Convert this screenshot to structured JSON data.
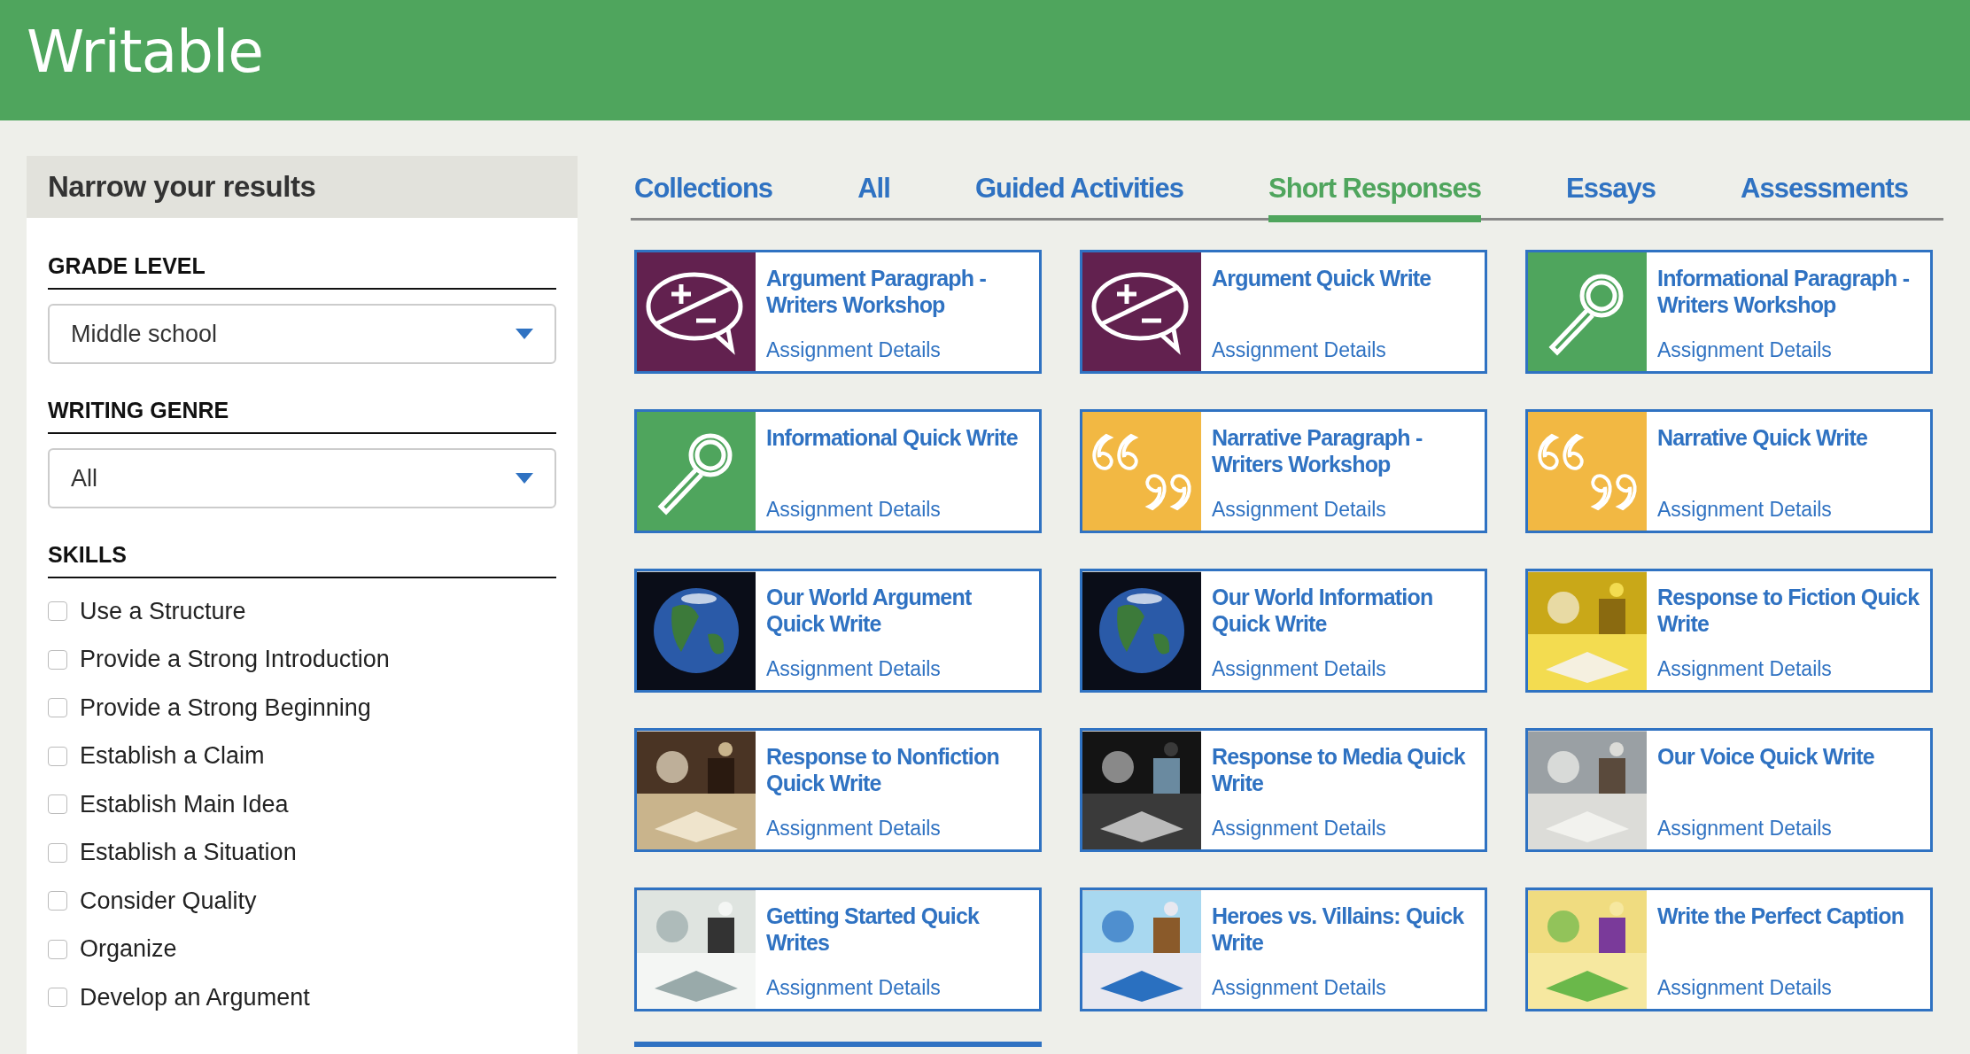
{
  "header": {
    "logo": "Writable"
  },
  "sidebar": {
    "title": "Narrow your results",
    "filters": [
      {
        "label": "GRADE LEVEL",
        "value": "Middle school"
      },
      {
        "label": "WRITING GENRE",
        "value": "All"
      }
    ],
    "skills_label": "SKILLS",
    "skills": [
      {
        "label": "Use a Structure",
        "checked": false
      },
      {
        "label": "Provide a Strong Introduction",
        "checked": false
      },
      {
        "label": "Provide a Strong Beginning",
        "checked": false
      },
      {
        "label": "Establish a Claim",
        "checked": false
      },
      {
        "label": "Establish Main Idea",
        "checked": false
      },
      {
        "label": "Establish a Situation",
        "checked": false
      },
      {
        "label": "Consider Quality",
        "checked": false
      },
      {
        "label": "Organize",
        "checked": false
      },
      {
        "label": "Develop an Argument",
        "checked": false
      }
    ]
  },
  "tabs": [
    {
      "label": "Collections",
      "selected": false
    },
    {
      "label": "All",
      "selected": false
    },
    {
      "label": "Guided Activities",
      "selected": false
    },
    {
      "label": "Short Responses",
      "selected": true
    },
    {
      "label": "Essays",
      "selected": false
    },
    {
      "label": "Assessments",
      "selected": false
    }
  ],
  "cards": [
    {
      "title": "Argument Paragraph - Writers Workshop",
      "link": "Assignment Details",
      "kind": "debate"
    },
    {
      "title": "Argument Quick Write",
      "link": "Assignment Details",
      "kind": "debate"
    },
    {
      "title": "Informational Paragraph - Writers Workshop",
      "link": "Assignment Details",
      "kind": "magnifier"
    },
    {
      "title": "Informational Quick Write",
      "link": "Assignment Details",
      "kind": "magnifier"
    },
    {
      "title": "Narrative Paragraph - Writers Workshop",
      "link": "Assignment Details",
      "kind": "quotes"
    },
    {
      "title": "Narrative Quick Write",
      "link": "Assignment Details",
      "kind": "quotes"
    },
    {
      "title": "Our World Argument Quick Write",
      "link": "Assignment Details",
      "kind": "picture"
    },
    {
      "title": "Our World Information Quick Write",
      "link": "Assignment Details",
      "kind": "picture"
    },
    {
      "title": "Response to Fiction Quick Write",
      "link": "Assignment Details",
      "kind": "picture"
    },
    {
      "title": "Response to Nonfiction Quick Write",
      "link": "Assignment Details",
      "kind": "picture"
    },
    {
      "title": "Response to Media Quick Write",
      "link": "Assignment Details",
      "kind": "picture"
    },
    {
      "title": "Our Voice Quick Write",
      "link": "Assignment Details",
      "kind": "picture"
    },
    {
      "title": "Getting Started Quick Writes",
      "link": "Assignment Details",
      "kind": "picture"
    },
    {
      "title": "Heroes vs. Villains: Quick Write",
      "link": "Assignment Details",
      "kind": "picture"
    },
    {
      "title": "Write the Perfect Caption",
      "link": "Assignment Details",
      "kind": "picture"
    }
  ]
}
